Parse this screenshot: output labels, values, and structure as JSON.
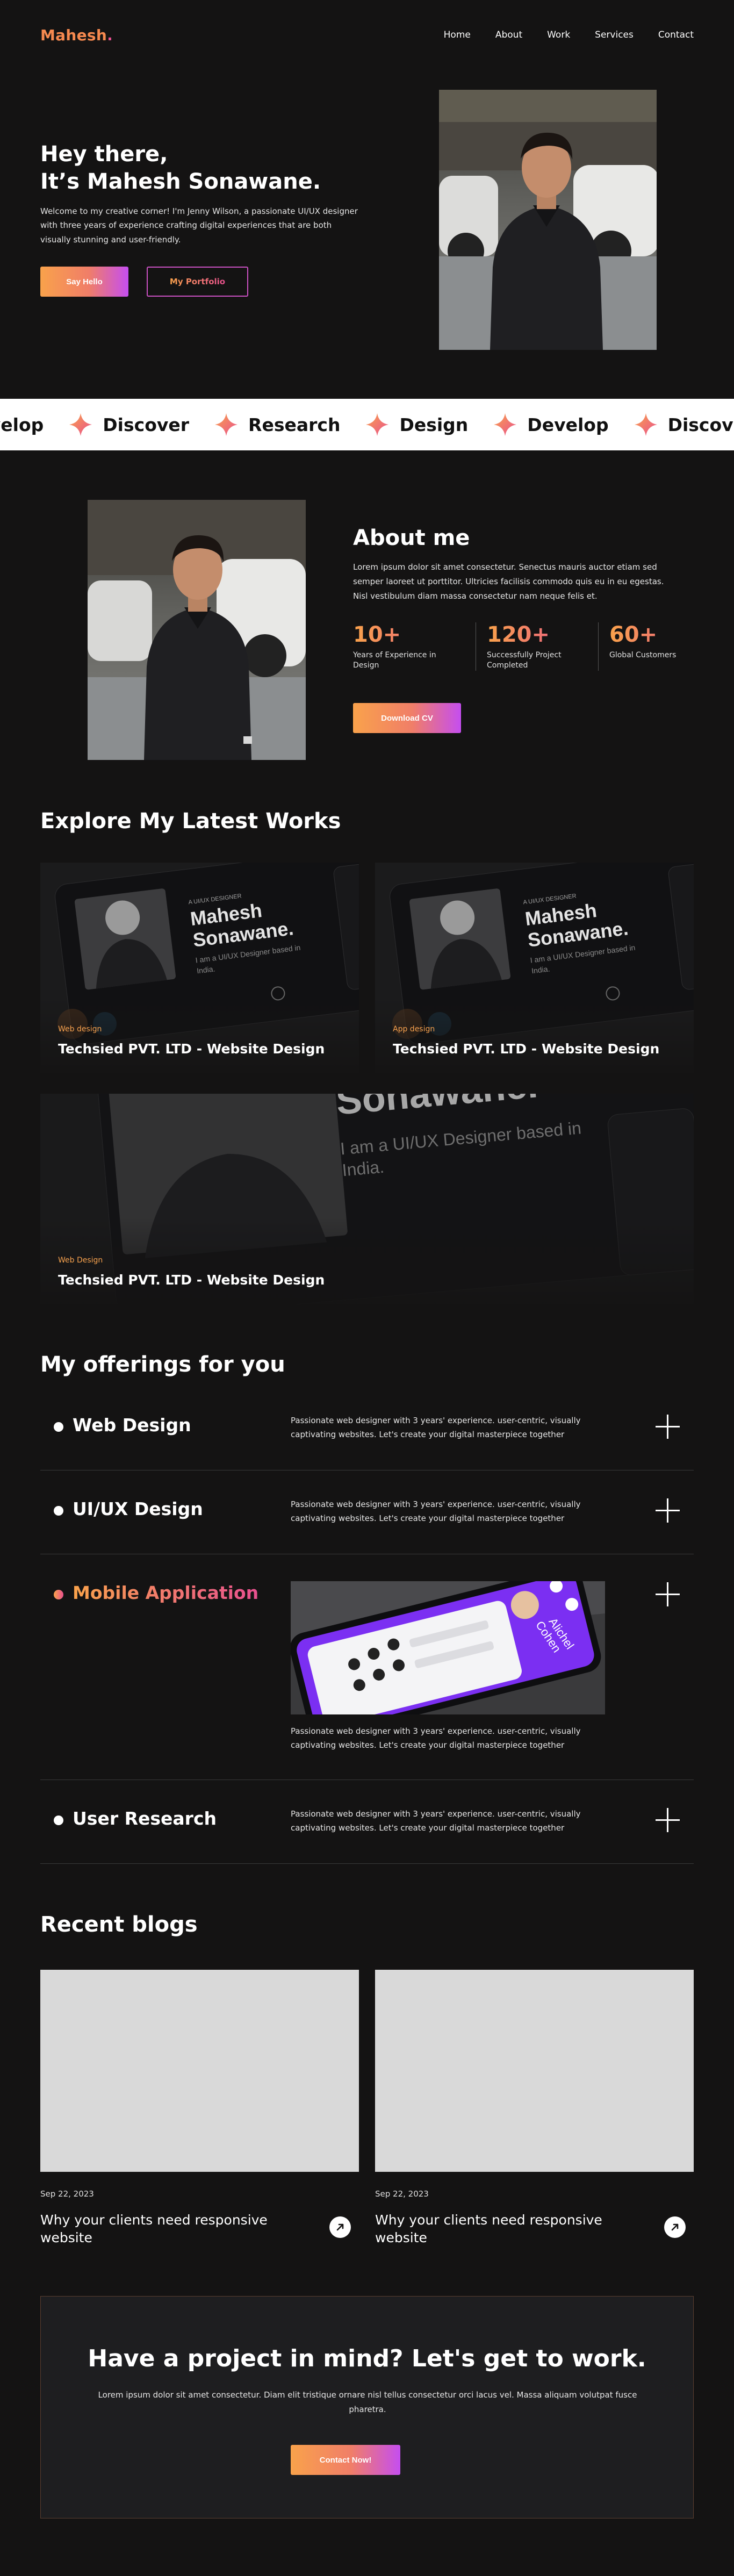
{
  "nav": {
    "logo": "Mahesh",
    "logo_dot": ".",
    "links": [
      "Home",
      "About",
      "Work",
      "Services",
      "Contact"
    ]
  },
  "hero": {
    "line1": "Hey there,",
    "line2": "It’s Mahesh Sonawane.",
    "description": "Welcome to my creative corner! I'm Jenny Wilson, a passionate UI/UX designer with three years of  experience crafting digital experiences that are both visually stunning and user-friendly.",
    "primary_button": "Say Hello",
    "secondary_button": "My Portfolio"
  },
  "marquee": {
    "items": [
      "Develop",
      "Discover",
      "Research",
      "Design",
      "Develop",
      "Discover"
    ],
    "star_color": "#f6894f"
  },
  "about": {
    "title": "About me",
    "description": "Lorem ipsum dolor sit amet consectetur. Senectus mauris auctor etiam sed semper laoreet ut porttitor. Ultricies facilisis commodo quis eu in eu egestas. Nisl vestibulum diam massa consectetur nam neque felis et.",
    "stats": [
      {
        "value": "10+",
        "label": "Years of Experience in Design"
      },
      {
        "value": "120+",
        "label": "Successfully Project Completed"
      },
      {
        "value": "60+",
        "label": "Global Customers"
      }
    ],
    "button": "Download CV"
  },
  "works": {
    "title": "Explore My Latest Works",
    "card_art_text": {
      "line1": "A UI/UX DESIGNER",
      "line2": "Mahesh",
      "line3": "Sonawane.",
      "line4": "I am a UI/UX Designer based in",
      "line5": "India."
    },
    "items": [
      {
        "tag": "Web design",
        "title": "Techsied PVT. LTD - Website Design"
      },
      {
        "tag": "App design",
        "title": "Techsied PVT. LTD - Website Design"
      },
      {
        "tag": "Web Design",
        "title": "Techsied PVT. LTD - Website Design"
      }
    ]
  },
  "offerings": {
    "title": "My offerings for you",
    "items": [
      {
        "title": "Web Design",
        "description": "Passionate web designer with 3 years' experience. user-centric, visually captivating websites. Let's create your digital masterpiece together"
      },
      {
        "title": "UI/UX Design",
        "description": "Passionate web designer with 3 years' experience. user-centric, visually captivating websites. Let's create your digital masterpiece together"
      },
      {
        "title": "Mobile Application",
        "description": "Passionate web designer with 3 years' experience. user-centric, visually captivating websites. Let's create your digital masterpiece together",
        "active": true
      },
      {
        "title": "User Research",
        "description": "Passionate web designer with 3 years' experience. user-centric, visually captivating websites. Let's create your digital masterpiece together"
      }
    ],
    "phone_text": {
      "name_line1": "Alichel",
      "name_line2": "Cohen"
    }
  },
  "blogs": {
    "title": "Recent blogs",
    "items": [
      {
        "date": "Sep 22, 2023",
        "title": "Why your clients need responsive website"
      },
      {
        "date": "Sep 22, 2023",
        "title": "Why your clients need responsive website"
      }
    ]
  },
  "cta": {
    "title": "Have a project in mind? Let's get to work.",
    "description": "Lorem ipsum dolor sit amet consectetur. Diam elit tristique ornare nisl tellus consectetur orci lacus vel. Massa aliquam volutpat fusce pharetra.",
    "button": "Contact Now!"
  },
  "colors": {
    "background": "#141313",
    "accent_orange": "#f6894f",
    "accent_pink": "#e9508f",
    "accent_purple": "#c54ef0",
    "phone_purple": "#7b2ff2"
  }
}
